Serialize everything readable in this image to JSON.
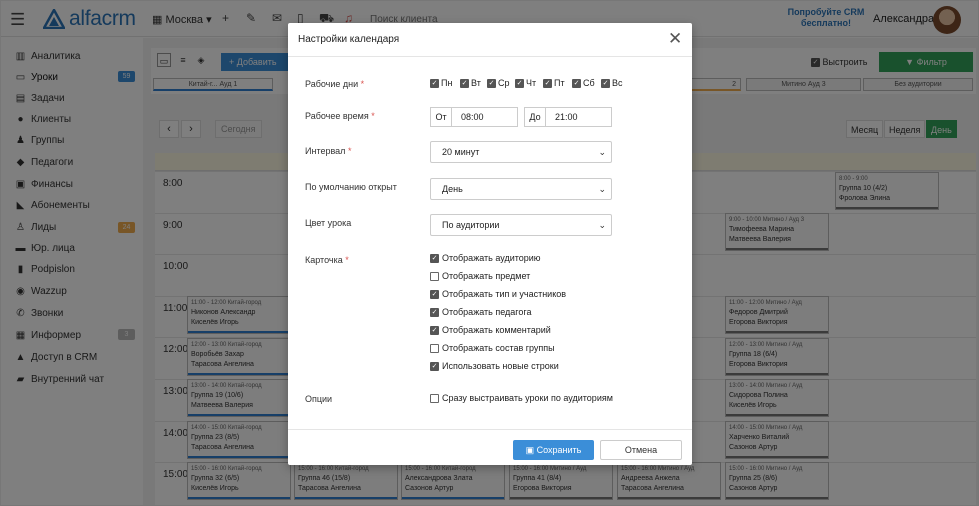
{
  "header": {
    "logo_text": "alfacrm",
    "city": "Москва",
    "search_placeholder": "Поиск клиента",
    "promo": "Попробуйте CRM бесплатно!",
    "user": "Александра"
  },
  "sidebar": {
    "items": [
      {
        "label": "Аналитика",
        "icon": "analytics-icon"
      },
      {
        "label": "Уроки",
        "badge": "59",
        "badge_color": "#3b8ed8"
      },
      {
        "label": "Задачи"
      },
      {
        "label": "Клиенты"
      },
      {
        "label": "Группы"
      },
      {
        "label": "Педагоги"
      },
      {
        "label": "Финансы"
      },
      {
        "label": "Абонементы"
      },
      {
        "label": "Лиды",
        "badge": "24",
        "badge_color": "#f0ad4e"
      },
      {
        "label": "Юр. лица"
      },
      {
        "label": "Podpislon"
      },
      {
        "label": "Wazzup"
      },
      {
        "label": "Звонки"
      },
      {
        "label": "Информер",
        "badge": "3",
        "badge_color": "#bbbbbb"
      },
      {
        "label": "Доступ в CRM"
      },
      {
        "label": "Внутренний чат"
      }
    ]
  },
  "toolbar": {
    "add_label": "+ Добавить",
    "rebuild_label": "Выстроить",
    "filter_label": "Фильтр",
    "room_tabs": [
      "Китай-г... Ауд 1",
      "2",
      "Митино Ауд 3",
      "Без аудитории"
    ],
    "today_label": "Сегодня",
    "views": [
      "Месяц",
      "Неделя",
      "День"
    ]
  },
  "calendar": {
    "times": [
      "8:00",
      "9:00",
      "10:00",
      "11:00",
      "12:00",
      "13:00",
      "14:00",
      "15:00"
    ],
    "events": [
      {
        "l1": "8:00 - 9:00",
        "l2": "Группа 10 (4/2)",
        "l3": "Фролова Элина",
        "bar": "#777"
      },
      {
        "l1": "9:00 - 10:00 Митино / Ауд 3",
        "l2": "Тимофеева Марина",
        "l3": "Матвеева Валерия",
        "bar": "#777"
      },
      {
        "l1": "11:00 - 12:00 Китай-город",
        "l2": "Никонов Александр",
        "l3": "Киселёв Игорь",
        "bar": "#2f7fd0"
      },
      {
        "l1": "11:00 - 12:00 Митино / Ауд",
        "l2": "Федоров Дмитрий",
        "l3": "Егорова Виктория",
        "bar": "#777"
      },
      {
        "l1": "12:00 - 13:00 Китай-город",
        "l2": "Воробьёв Захар",
        "l3": "Тарасова Ангелина",
        "bar": "#2f7fd0"
      },
      {
        "l1": "12:00 - 13:00 Митино / Ауд",
        "l2": "Группа 18 (6/4)",
        "l3": "Егорова Виктория",
        "bar": "#777"
      },
      {
        "l1": "13:00 - 14:00 Китай-город",
        "l2": "Группа 19 (10/6)",
        "l3": "Матвеева Валерия",
        "bar": "#2f7fd0"
      },
      {
        "l1": "13:00 - 14:00 Митино / Ауд",
        "l2": "Сидорова Полина",
        "l3": "Киселёв Игорь",
        "bar": "#777"
      },
      {
        "l1": "14:00 - 15:00 Китай-город",
        "l2": "Группа 23 (8/5)",
        "l3": "Тарасова Ангелина",
        "bar": "#2f7fd0"
      },
      {
        "l1": "14:00 - 15:00 Митино / Ауд",
        "l2": "Харченко Виталий",
        "l3": "Сазонов Артур",
        "bar": "#777"
      },
      {
        "l1": "15:00 - 16:00 Китай-город",
        "l2": "Группа 32 (6/5)",
        "l3": "Киселёв Игорь",
        "bar": "#2f7fd0"
      },
      {
        "l1": "15:00 - 16:00 Китай-город",
        "l2": "Группа 46 (15/8)",
        "l3": "Тарасова Ангелина",
        "bar": "#2f7fd0"
      },
      {
        "l1": "15:00 - 16:00 Китай-город",
        "l2": "Александрова Злата",
        "l3": "Сазонов Артур",
        "bar": "#2f7fd0"
      },
      {
        "l1": "15:00 - 16:00 Митино / Ауд",
        "l2": "Группа 41 (8/4)",
        "l3": "Егорова Виктория",
        "bar": "#777"
      },
      {
        "l1": "15:00 - 16:00 Митино / Ауд",
        "l2": "Андреева Анжела",
        "l3": "Тарасова Ангелина",
        "bar": "#777"
      },
      {
        "l1": "15:00 - 16:00 Митино / Ауд",
        "l2": "Группа 25 (8/6)",
        "l3": "Сазонов Артур",
        "bar": "#777"
      }
    ]
  },
  "modal": {
    "title": "Настройки календаря",
    "work_days_label": "Рабочие дни",
    "days": [
      {
        "label": "Пн",
        "checked": true
      },
      {
        "label": "Вт",
        "checked": true
      },
      {
        "label": "Ср",
        "checked": true
      },
      {
        "label": "Чт",
        "checked": true
      },
      {
        "label": "Пт",
        "checked": true
      },
      {
        "label": "Сб",
        "checked": true
      },
      {
        "label": "Вс",
        "checked": true
      }
    ],
    "work_time_label": "Рабочее время",
    "from_prefix": "От",
    "from_value": "08:00",
    "to_prefix": "До",
    "to_value": "21:00",
    "interval_label": "Интервал",
    "interval_value": "20 минут",
    "default_open_label": "По умолчанию открыт",
    "default_open_value": "День",
    "lesson_color_label": "Цвет урока",
    "lesson_color_value": "По аудитории",
    "card_label": "Карточка",
    "card_options": [
      {
        "label": "Отображать аудиторию",
        "checked": true
      },
      {
        "label": "Отображать предмет",
        "checked": false
      },
      {
        "label": "Отображать тип и участников",
        "checked": true
      },
      {
        "label": "Отображать педагога",
        "checked": true
      },
      {
        "label": "Отображать комментарий",
        "checked": true
      },
      {
        "label": "Отображать состав группы",
        "checked": false
      },
      {
        "label": "Использовать новые строки",
        "checked": true
      }
    ],
    "options_label": "Опции",
    "options_option": {
      "label": "Сразу выстраивать уроки по аудиториям",
      "checked": false
    },
    "save_label": "Сохранить",
    "cancel_label": "Отмена"
  }
}
